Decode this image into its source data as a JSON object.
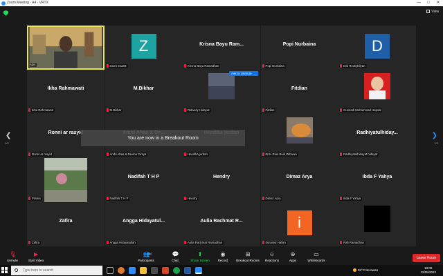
{
  "window": {
    "title": "Zoom Meeting - A4 - VRTX",
    "controls": [
      "—",
      "□",
      "✕"
    ]
  },
  "topbar": {
    "view_label": "View"
  },
  "tiles": [
    {
      "name": "",
      "label": "Ade",
      "type": "video",
      "active": true
    },
    {
      "name": "",
      "label": "zoom Eaa04",
      "type": "avatar",
      "letter": "Z",
      "color": "#1ea3a3"
    },
    {
      "name": "Krisna Bayu Ram...",
      "label": "Krisna Bayu Ramadhan",
      "type": "name"
    },
    {
      "name": "Popi Nurbaina",
      "label": "Popi Nurbaina",
      "type": "name"
    },
    {
      "name": "",
      "label": "Dwi Rezkybilyan",
      "type": "avatar",
      "letter": "D",
      "color": "#1e5fa8"
    },
    {
      "name": "Ikha Rahmawati",
      "label": "Ikha Rahmawati",
      "type": "name"
    },
    {
      "name": "M.Bikhar",
      "label": "M.Bikhar",
      "type": "name"
    },
    {
      "name": "",
      "label": "Ridandy Hidayat",
      "type": "photo-dark"
    },
    {
      "name": "Fitdian",
      "label": "Fitdian",
      "type": "name"
    },
    {
      "name": "",
      "label": "Gusnadi Mohammad Hapsal",
      "type": "photo-red"
    },
    {
      "name": "Ronni ar rasyid",
      "label": "Ronni ar rasyid",
      "type": "name"
    },
    {
      "name": "Andri Abas & De...",
      "label": "Andri Abas & Devina Cintya",
      "type": "name"
    },
    {
      "name": "Hendika jordan",
      "label": "Hendika jordan",
      "type": "name"
    },
    {
      "name": "",
      "label": "Ermi Rian Budi Wibowo",
      "type": "photo-cat"
    },
    {
      "name": "Radhiyatulhiday...",
      "label": "Radhiyatulhidayat hidayat",
      "type": "name"
    },
    {
      "name": "",
      "label": "Prama",
      "type": "photo-outdoor"
    },
    {
      "name": "Nadifah T H P",
      "label": "Nadifah T H P",
      "type": "name"
    },
    {
      "name": "Hendry",
      "label": "Hendry",
      "type": "name"
    },
    {
      "name": "Dimaz Arya",
      "label": "Dimaz Arya",
      "type": "name"
    },
    {
      "name": "Ibda F Yahya",
      "label": "Ibda F Yahya",
      "type": "name"
    },
    {
      "name": "Zafira",
      "label": "Zafira",
      "type": "name"
    },
    {
      "name": "Angga Hidayatul...",
      "label": "Angga Hidayatullah",
      "type": "name"
    },
    {
      "name": "Aulia Rachmat R...",
      "label": "Aulia Rachmat Ramadhan",
      "type": "name"
    },
    {
      "name": "",
      "label": "Itsnainul Hakim",
      "type": "avatar",
      "letter": "i",
      "color": "#f26522"
    },
    {
      "name": "",
      "label": "Rafi Ramadhan",
      "type": "black"
    }
  ],
  "ask_to_unmute": "Ask to Unmute",
  "ask_more": "...",
  "breakout_message": "You are now in a Breakout Room",
  "pagination": {
    "left": "1/2",
    "right": "1/2"
  },
  "toolbar": {
    "unmute": "Unmute",
    "start_video": "Start Video",
    "participants": "Participants",
    "participants_count": "30",
    "chat": "Chat",
    "share_screen": "Share Screen",
    "record": "Record",
    "breakout_rooms": "Breakout Rooms",
    "reactions": "Reactions",
    "apps": "Apps",
    "whiteboards": "Whiteboards",
    "leave": "Leave Room"
  },
  "taskbar": {
    "search_placeholder": "Type here to search",
    "weather": "28°C  Berawan",
    "time": "19:08",
    "date": "12/05/2022"
  }
}
